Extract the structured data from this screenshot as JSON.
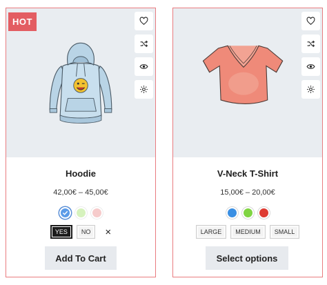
{
  "products": [
    {
      "badge": "HOT",
      "name": "Hoodie",
      "price": "42,00€ – 45,00€",
      "swatches": [
        {
          "color": "#5b9be8",
          "selected": true
        },
        {
          "color": "#a6e36e",
          "selected": false
        },
        {
          "color": "#ec8e8e",
          "selected": false
        }
      ],
      "options": [
        {
          "label": "YES",
          "active": true
        },
        {
          "label": "NO",
          "active": false
        }
      ],
      "clear_label": "×",
      "cta": "Add To Cart"
    },
    {
      "name": "V-Neck T-Shirt",
      "price": "15,00€ – 20,00€",
      "swatches": [
        {
          "color": "#3a8fe3"
        },
        {
          "color": "#7fd442"
        },
        {
          "color": "#de3c33"
        }
      ],
      "options": [
        {
          "label": "LARGE"
        },
        {
          "label": "MEDIUM"
        },
        {
          "label": "SMALL"
        }
      ],
      "cta": "Select options"
    }
  ],
  "actions": [
    "heart-icon",
    "shuffle-icon",
    "eye-icon",
    "gear-icon"
  ],
  "colors": {
    "card_border": "#e97b7f",
    "badge_hot": "#e35d62",
    "media_bg": "#e9edf1",
    "button_bg": "#e7eaee"
  }
}
